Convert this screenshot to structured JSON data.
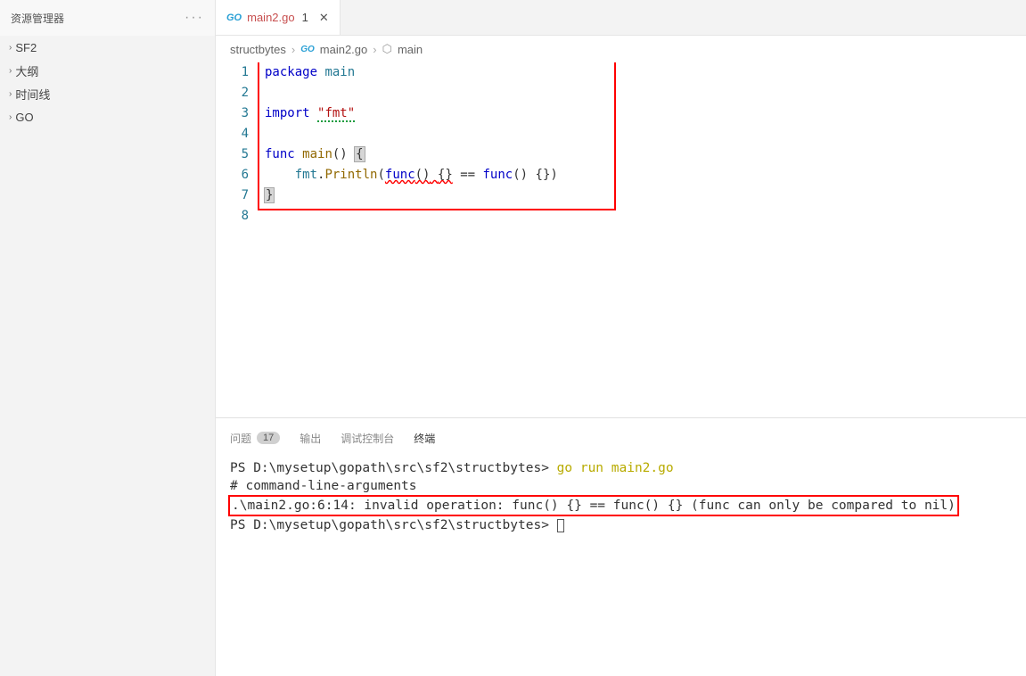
{
  "sidebar": {
    "title": "资源管理器",
    "items": [
      {
        "label": "SF2"
      },
      {
        "label": "大纲"
      },
      {
        "label": "时间线"
      },
      {
        "label": "GO"
      }
    ]
  },
  "tab": {
    "icon": "GO",
    "label": "main2.go",
    "modified": "1"
  },
  "breadcrumb": {
    "items": [
      "structbytes",
      "main2.go",
      "main"
    ]
  },
  "editor": {
    "line_numbers": [
      "1",
      "2",
      "3",
      "4",
      "5",
      "6",
      "7",
      "8"
    ],
    "tokens": {
      "package": "package",
      "main": "main",
      "import": "import",
      "fmt_str": "\"fmt\"",
      "func": "func",
      "main_fn": "main",
      "paren": "()",
      "lbrace": "{",
      "rbrace": "}",
      "fmt_pkg": "fmt",
      "dot": ".",
      "println": "Println",
      "lp": "(",
      "func_kw": "func",
      "unit": "()",
      "space": " ",
      "empty": "{}",
      "eqeq": " == ",
      "rp": ")"
    }
  },
  "panel": {
    "tabs": {
      "problems": "问题",
      "problems_count": "17",
      "output": "输出",
      "debug": "调试控制台",
      "terminal": "终端"
    },
    "terminal": {
      "prompt1": "PS D:\\mysetup\\gopath\\src\\sf2\\structbytes> ",
      "cmd1": "go run main2.go",
      "line2": "# command-line-arguments",
      "err": ".\\main2.go:6:14: invalid operation: func() {} == func() {} (func can only be compared to nil)",
      "prompt2": "PS D:\\mysetup\\gopath\\src\\sf2\\structbytes> "
    }
  }
}
